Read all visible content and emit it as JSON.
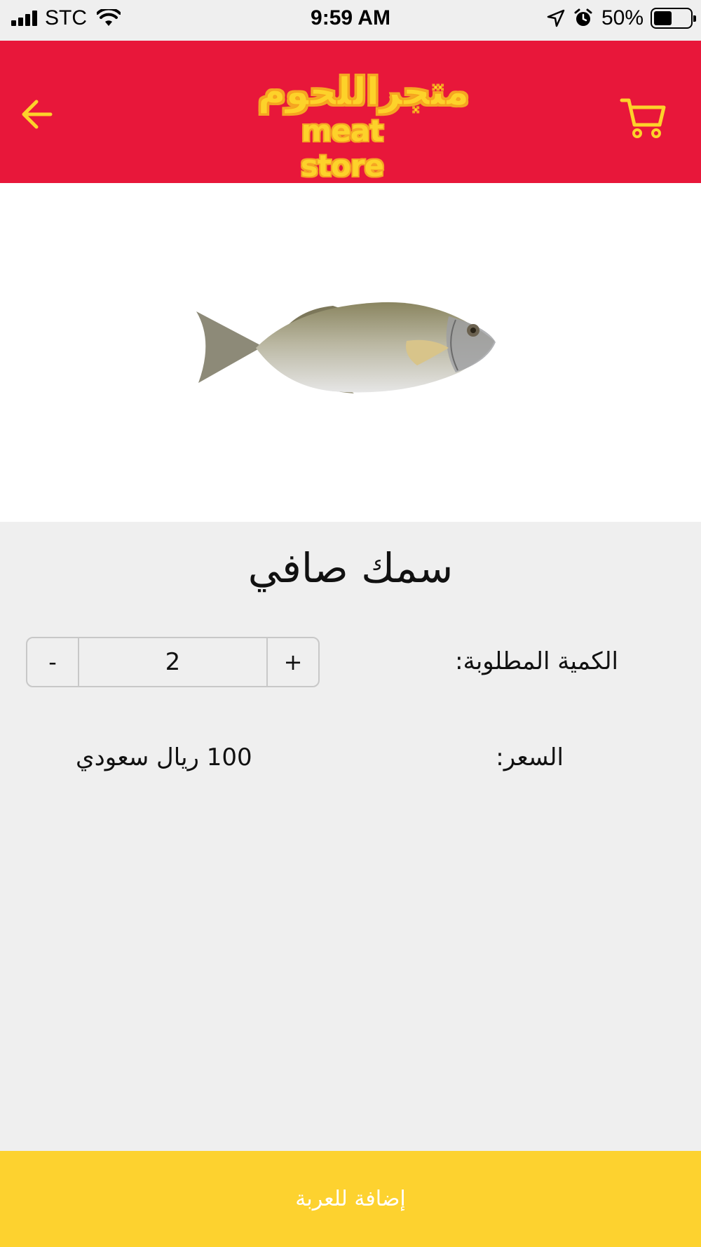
{
  "status_bar": {
    "carrier": "STC",
    "time": "9:59 AM",
    "battery_percent": "50%",
    "battery_level": 0.5,
    "icons": [
      "signal-icon",
      "wifi-icon",
      "location-arrow-icon",
      "alarm-icon",
      "battery-icon"
    ]
  },
  "header": {
    "background_color": "#e8173a",
    "accent_color": "#fdd22a",
    "logo": {
      "arabic_text": "متجراللحوم",
      "english_text": "meat store"
    },
    "back_icon": "arrow-left-icon",
    "cart_icon": "shopping-cart-icon"
  },
  "product": {
    "image_description_icon": "fish-image",
    "name": "سمك صافي",
    "quantity_label": "الكمية المطلوبة:",
    "quantity": "2",
    "decrement_label": "-",
    "increment_label": "+",
    "price_label": "السعر:",
    "price_value": "100 ريال سعودي"
  },
  "footer": {
    "add_to_cart_label": "إضافة للعربة",
    "button_color": "#fdd22f"
  }
}
